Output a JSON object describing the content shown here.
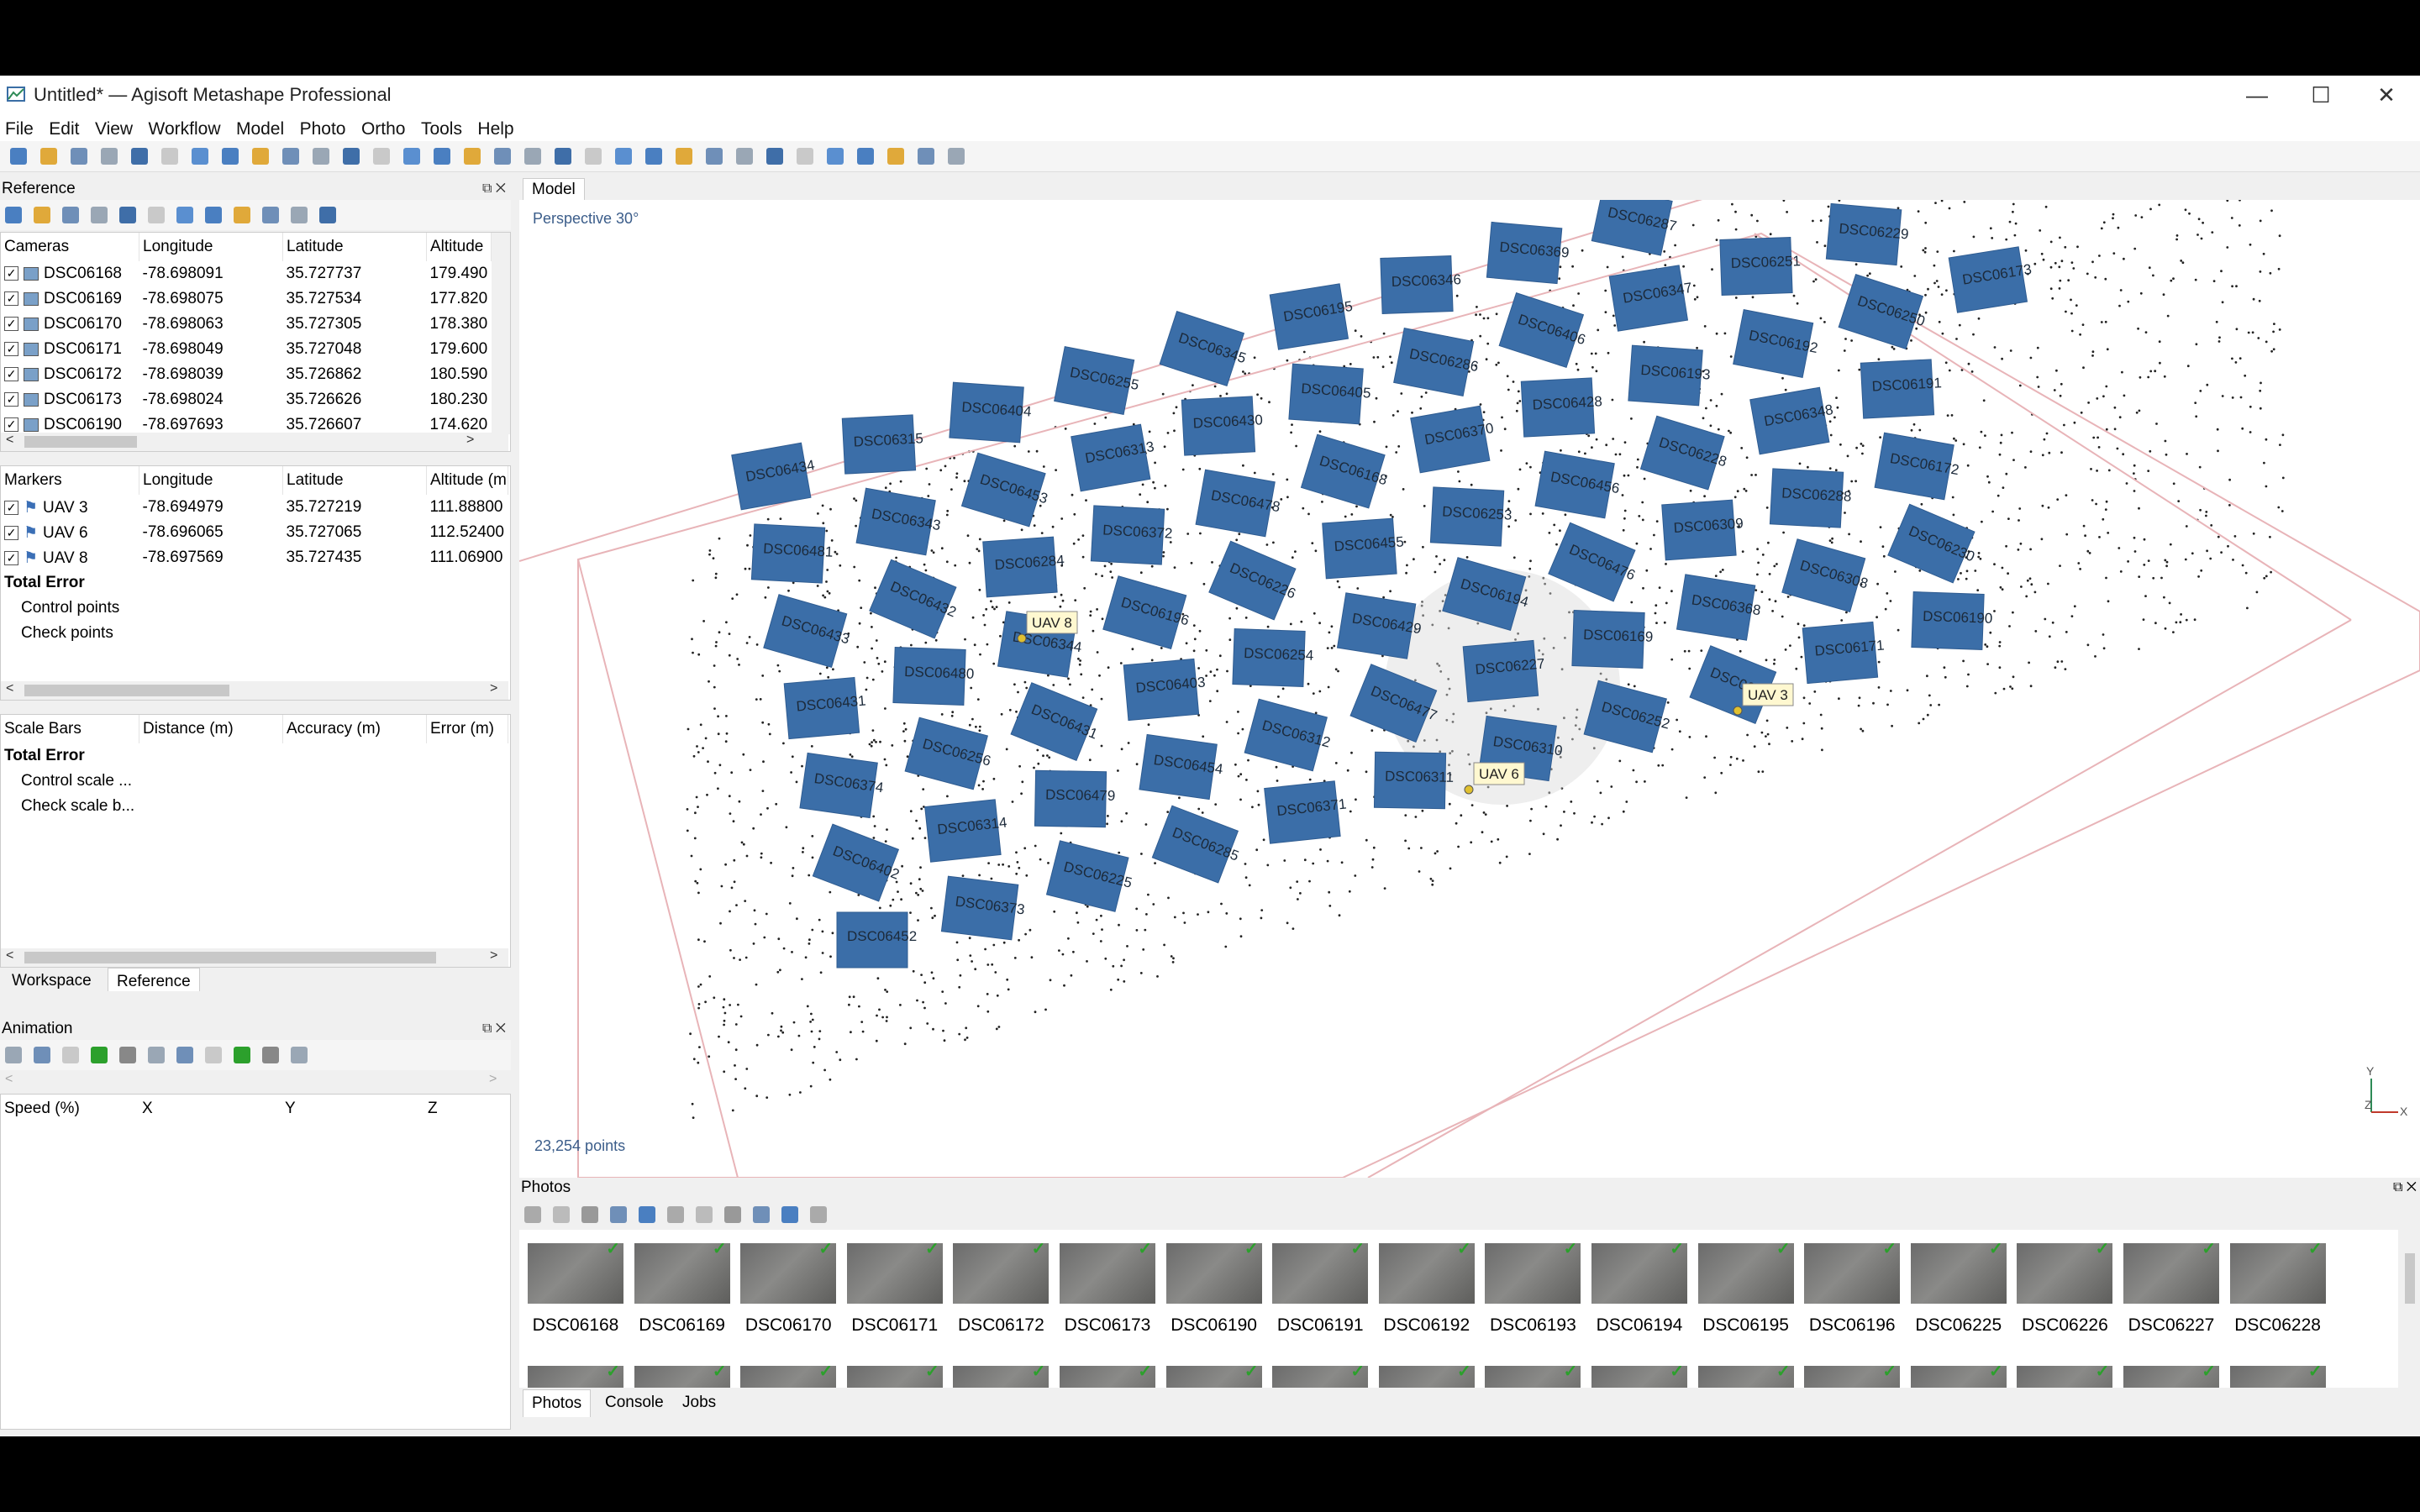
{
  "window": {
    "title": "Untitled* — Agisoft Metashape Professional",
    "controls": [
      "—",
      "☐",
      "✕"
    ]
  },
  "menu": [
    "File",
    "Edit",
    "View",
    "Workflow",
    "Model",
    "Photo",
    "Ortho",
    "Tools",
    "Help"
  ],
  "reference_panel": {
    "title": "Reference",
    "cameras": {
      "headers": [
        "Cameras",
        "Longitude",
        "Latitude",
        "Altitude"
      ],
      "rows": [
        [
          "DSC06168",
          "-78.698091",
          "35.727737",
          "179.490"
        ],
        [
          "DSC06169",
          "-78.698075",
          "35.727534",
          "177.820"
        ],
        [
          "DSC06170",
          "-78.698063",
          "35.727305",
          "178.380"
        ],
        [
          "DSC06171",
          "-78.698049",
          "35.727048",
          "179.600"
        ],
        [
          "DSC06172",
          "-78.698039",
          "35.726862",
          "180.590"
        ],
        [
          "DSC06173",
          "-78.698024",
          "35.726626",
          "180.230"
        ],
        [
          "DSC06190",
          "-78.697693",
          "35.726607",
          "174.620"
        ]
      ]
    },
    "markers": {
      "headers": [
        "Markers",
        "Longitude",
        "Latitude",
        "Altitude (m"
      ],
      "rows": [
        [
          "UAV 3",
          "-78.694979",
          "35.727219",
          "111.88800"
        ],
        [
          "UAV 6",
          "-78.696065",
          "35.727065",
          "112.52400"
        ],
        [
          "UAV 8",
          "-78.697569",
          "35.727435",
          "111.06900"
        ]
      ],
      "total": "Total Error",
      "sub": [
        "Control points",
        "Check points"
      ]
    },
    "scalebars": {
      "headers": [
        "Scale Bars",
        "Distance (m)",
        "Accuracy (m)",
        "Error (m)"
      ],
      "total": "Total Error",
      "sub": [
        "Control scale ...",
        "Check scale b..."
      ]
    },
    "tabs": [
      "Workspace",
      "Reference"
    ]
  },
  "animation_panel": {
    "title": "Animation",
    "headers": [
      "Speed (%)",
      "X",
      "Y",
      "Z"
    ]
  },
  "model_view": {
    "tab": "Model",
    "projection": "Perspective 30°",
    "points": "23,254 points",
    "axes": [
      "Y",
      "Z",
      "X"
    ],
    "camera_labels": [
      "DSC06434",
      "DSC06481",
      "DSC06433",
      "DSC06431",
      "DSC06374",
      "DSC06402",
      "DSC06452",
      "DSC06315",
      "DSC06343",
      "DSC06432",
      "DSC06480",
      "DSC06256",
      "DSC06314",
      "DSC06373",
      "DSC06404",
      "DSC06453",
      "DSC06284",
      "DSC06344",
      "DSC06431",
      "DSC06479",
      "DSC06225",
      "DSC06255",
      "DSC06313",
      "DSC06372",
      "DSC06196",
      "DSC06403",
      "DSC06454",
      "DSC06285",
      "DSC06345",
      "DSC06430",
      "DSC06478",
      "DSC06226",
      "DSC06254",
      "DSC06312",
      "DSC06371",
      "DSC06195",
      "DSC06405",
      "DSC06168",
      "DSC06455",
      "DSC06429",
      "DSC06477",
      "DSC06311",
      "DSC06346",
      "DSC06286",
      "DSC06370",
      "DSC06253",
      "DSC06194",
      "DSC06227",
      "DSC06310",
      "DSC06369",
      "DSC06406",
      "DSC06428",
      "DSC06456",
      "DSC06476",
      "DSC06169",
      "DSC06252",
      "DSC06287",
      "DSC06347",
      "DSC06193",
      "DSC06228",
      "DSC06309",
      "DSC06368",
      "DSC06170",
      "DSC06251",
      "DSC06192",
      "DSC06348",
      "DSC06288",
      "DSC06308",
      "DSC06171",
      "DSC06229",
      "DSC06250",
      "DSC06191",
      "DSC06172",
      "DSC06230",
      "DSC06190",
      "DSC06173"
    ],
    "markers": [
      "UAV 8",
      "UAV 6",
      "UAV 3"
    ]
  },
  "photos_panel": {
    "title": "Photos",
    "row1": [
      "DSC06168",
      "DSC06169",
      "DSC06170",
      "DSC06171",
      "DSC06172",
      "DSC06173",
      "DSC06190",
      "DSC06191",
      "DSC06192",
      "DSC06193",
      "DSC06194",
      "DSC06195",
      "DSC06196",
      "DSC06225",
      "DSC06226",
      "DSC06227",
      "DSC06228"
    ],
    "tabs": [
      "Photos",
      "Console",
      "Jobs"
    ]
  }
}
